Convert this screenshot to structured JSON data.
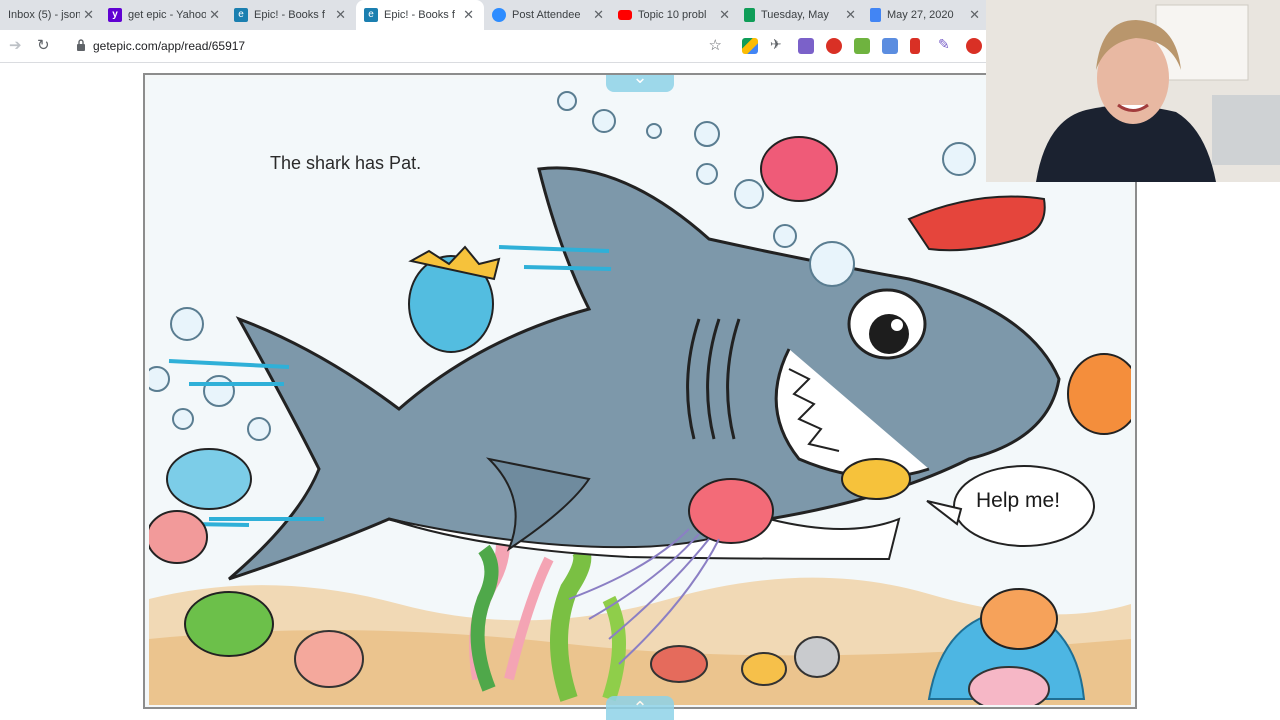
{
  "browser": {
    "tabs": [
      {
        "title": "Inbox (5) - json",
        "favicon": "gmail-icon",
        "color": "#d93025"
      },
      {
        "title": "get epic - Yahoo",
        "favicon": "yahoo-icon",
        "color": "#6001d2"
      },
      {
        "title": "Epic! - Books f",
        "favicon": "epic-icon",
        "color": "#1b7fb0"
      },
      {
        "title": "Epic! - Books f",
        "favicon": "epic-icon",
        "color": "#1b7fb0",
        "active": true
      },
      {
        "title": "Post Attendee",
        "favicon": "zoom-icon",
        "color": "#2d8cff"
      },
      {
        "title": "Topic 10 probl",
        "favicon": "youtube-icon",
        "color": "#ff0000"
      },
      {
        "title": "Tuesday, May",
        "favicon": "sheets-icon",
        "color": "#0f9d58"
      },
      {
        "title": "May 27, 2020",
        "favicon": "docs-icon",
        "color": "#4285f4"
      }
    ],
    "url": "getepic.com/app/read/65917"
  },
  "book": {
    "page_text": "The shark has Pat.",
    "speech_bubble": "Help me!"
  },
  "colors": {
    "shark": "#7d98aa",
    "water": "#eef5f7",
    "accent_blue": "#2fb0d8"
  }
}
